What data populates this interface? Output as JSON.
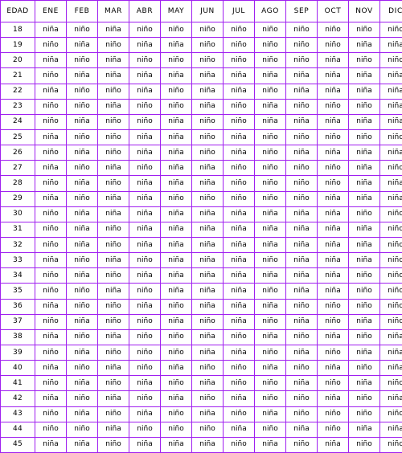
{
  "table": {
    "age_header": "EDAD",
    "month_headers": [
      "ENE",
      "FEB",
      "MAR",
      "ABR",
      "MAY",
      "JUN",
      "JUL",
      "AGO",
      "SEP",
      "OCT",
      "NOV",
      "DIC"
    ],
    "labels": {
      "girl": "niña",
      "boy": "niño"
    },
    "colors": {
      "girl_bg": "#ffcccc",
      "boy_bg": "#66cccc",
      "border": "#a020f0",
      "header_bg": "#ffffff",
      "text": "#000000"
    },
    "ages": [
      18,
      19,
      20,
      21,
      22,
      23,
      24,
      25,
      26,
      27,
      28,
      29,
      30,
      31,
      32,
      33,
      34,
      35,
      36,
      37,
      38,
      39,
      40,
      41,
      42,
      43,
      44,
      45
    ],
    "rows": [
      {
        "age": 18,
        "values": [
          "niña",
          "niño",
          "niña",
          "niño",
          "niño",
          "niño",
          "niño",
          "niño",
          "niño",
          "niño",
          "niño",
          "niño"
        ]
      },
      {
        "age": 19,
        "values": [
          "niño",
          "niña",
          "niño",
          "niña",
          "niña",
          "niño",
          "niño",
          "niño",
          "niño",
          "niño",
          "niña",
          "niña"
        ]
      },
      {
        "age": 20,
        "values": [
          "niña",
          "niño",
          "niña",
          "niño",
          "niño",
          "niño",
          "niño",
          "niño",
          "niño",
          "niña",
          "niño",
          "niño"
        ]
      },
      {
        "age": 21,
        "values": [
          "niño",
          "niña",
          "niña",
          "niña",
          "niña",
          "niña",
          "niña",
          "niña",
          "niña",
          "niña",
          "niña",
          "niña"
        ]
      },
      {
        "age": 22,
        "values": [
          "niña",
          "niño",
          "niño",
          "niña",
          "niño",
          "niña",
          "niña",
          "niño",
          "niña",
          "niña",
          "niña",
          "niña"
        ]
      },
      {
        "age": 23,
        "values": [
          "niño",
          "niño",
          "niña",
          "niño",
          "niño",
          "niña",
          "niño",
          "niña",
          "niño",
          "niño",
          "niño",
          "niña"
        ]
      },
      {
        "age": 24,
        "values": [
          "niño",
          "niña",
          "niño",
          "niño",
          "niña",
          "niño",
          "niño",
          "niña",
          "niña",
          "niña",
          "niña",
          "niña"
        ]
      },
      {
        "age": 25,
        "values": [
          "niña",
          "niño",
          "niño",
          "niña",
          "niña",
          "niño",
          "niña",
          "niño",
          "niño",
          "niño",
          "niño",
          "niño"
        ]
      },
      {
        "age": 26,
        "values": [
          "niño",
          "niña",
          "niño",
          "niña",
          "niña",
          "niño",
          "niña",
          "niño",
          "niña",
          "niña",
          "niña",
          "niña"
        ]
      },
      {
        "age": 27,
        "values": [
          "niña",
          "niño",
          "niña",
          "niño",
          "niña",
          "niña",
          "niño",
          "niño",
          "niño",
          "niño",
          "niña",
          "niño"
        ]
      },
      {
        "age": 28,
        "values": [
          "niño",
          "niña",
          "niño",
          "niña",
          "niña",
          "niña",
          "niño",
          "niño",
          "niño",
          "niño",
          "niña",
          "niña"
        ]
      },
      {
        "age": 29,
        "values": [
          "niña",
          "niño",
          "niña",
          "niña",
          "niño",
          "niño",
          "niño",
          "niño",
          "niño",
          "niña",
          "niña",
          "niña"
        ]
      },
      {
        "age": 30,
        "values": [
          "niño",
          "niña",
          "niña",
          "niña",
          "niña",
          "niña",
          "niña",
          "niña",
          "niña",
          "niña",
          "niño",
          "niño"
        ]
      },
      {
        "age": 31,
        "values": [
          "niño",
          "niña",
          "niño",
          "niña",
          "niña",
          "niña",
          "niña",
          "niña",
          "niña",
          "niña",
          "niña",
          "niño"
        ]
      },
      {
        "age": 32,
        "values": [
          "niño",
          "niña",
          "niño",
          "niña",
          "niña",
          "niña",
          "niña",
          "niña",
          "niña",
          "niña",
          "niña",
          "niño"
        ]
      },
      {
        "age": 33,
        "values": [
          "niña",
          "niño",
          "niña",
          "niño",
          "niña",
          "niña",
          "niña",
          "niño",
          "niña",
          "niña",
          "niña",
          "niño"
        ]
      },
      {
        "age": 34,
        "values": [
          "niño",
          "niña",
          "niño",
          "niña",
          "niña",
          "niña",
          "niña",
          "niña",
          "niña",
          "niña",
          "niño",
          "niño"
        ]
      },
      {
        "age": 35,
        "values": [
          "niño",
          "niño",
          "niña",
          "niño",
          "niña",
          "niña",
          "niña",
          "niño",
          "niña",
          "niña",
          "niño",
          "niño"
        ]
      },
      {
        "age": 36,
        "values": [
          "niña",
          "niño",
          "niño",
          "niña",
          "niño",
          "niña",
          "niña",
          "niña",
          "niño",
          "niño",
          "niño",
          "niño"
        ]
      },
      {
        "age": 37,
        "values": [
          "niño",
          "niña",
          "niño",
          "niño",
          "niña",
          "niño",
          "niña",
          "niño",
          "niña",
          "niño",
          "niña",
          "niño"
        ]
      },
      {
        "age": 38,
        "values": [
          "niña",
          "niño",
          "niña",
          "niño",
          "niño",
          "niña",
          "niño",
          "niña",
          "niño",
          "niña",
          "niño",
          "niña"
        ]
      },
      {
        "age": 39,
        "values": [
          "niño",
          "niña",
          "niño",
          "niño",
          "niño",
          "niña",
          "niña",
          "niño",
          "niña",
          "niño",
          "niña",
          "niña"
        ]
      },
      {
        "age": 40,
        "values": [
          "niña",
          "niño",
          "niña",
          "niño",
          "niña",
          "niño",
          "niño",
          "niña",
          "niño",
          "niña",
          "niño",
          "niña"
        ]
      },
      {
        "age": 41,
        "values": [
          "niño",
          "niña",
          "niño",
          "niña",
          "niño",
          "niña",
          "niño",
          "niño",
          "niña",
          "niño",
          "niña",
          "niño"
        ]
      },
      {
        "age": 42,
        "values": [
          "niña",
          "niño",
          "niña",
          "niño",
          "niña",
          "niño",
          "niña",
          "niño",
          "niño",
          "niña",
          "niño",
          "niña"
        ]
      },
      {
        "age": 43,
        "values": [
          "niño",
          "niña",
          "niño",
          "niña",
          "niño",
          "niña",
          "niño",
          "niña",
          "niño",
          "niño",
          "niño",
          "niño"
        ]
      },
      {
        "age": 44,
        "values": [
          "niño",
          "niño",
          "niña",
          "niño",
          "niño",
          "niño",
          "niña",
          "niño",
          "niña",
          "niño",
          "niña",
          "niña"
        ]
      },
      {
        "age": 45,
        "values": [
          "niña",
          "niña",
          "niño",
          "niña",
          "niña",
          "niña",
          "niño",
          "niña",
          "niño",
          "niña",
          "niño",
          "niño"
        ]
      }
    ]
  }
}
